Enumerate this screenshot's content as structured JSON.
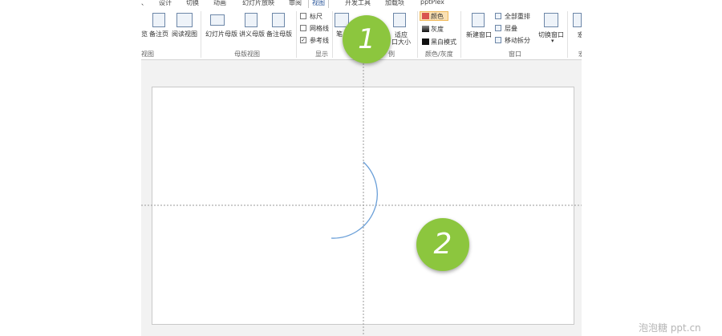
{
  "tabs": [
    "、",
    "设计",
    "切换",
    "动画",
    "幻灯片放映",
    "审阅",
    "视图",
    "开发工具",
    "加载项",
    "pptPlex"
  ],
  "active_tab": "视图",
  "ribbon": {
    "presentation_views": {
      "items": [
        "览",
        "备注页",
        "阅读视图"
      ],
      "group": "视图"
    },
    "master_views": {
      "items": [
        "幻灯片母版",
        "讲义母版",
        "备注母版"
      ],
      "group": "母版视图"
    },
    "show": {
      "ruler": "标尺",
      "gridlines": "网格线",
      "guides": "参考线",
      "guides_checked": "✓",
      "group": "显示"
    },
    "zoom": {
      "zoom_label": "笔",
      "fit_line1": "适应",
      "fit_line2": "口大小",
      "group": "例"
    },
    "color": {
      "color": "颜色",
      "grayscale": "灰度",
      "bw": "黑白模式",
      "group": "颜色/灰度"
    },
    "window": {
      "new_window": "新建窗口",
      "arrange_all": "全部重排",
      "cascade": "层叠",
      "move_split": "移动拆分",
      "switch_windows": "切换窗口",
      "switch_arrow": "▾",
      "group": "窗口"
    },
    "macros_fragment": {
      "label": "宏",
      "group": "宏"
    }
  },
  "badges": [
    "1",
    "2"
  ],
  "watermark": "泡泡糖 ppt.cn",
  "colors": {
    "badge_green": "#8cc63e",
    "arc_blue": "#6a9fd8",
    "guide_gray": "#9a9a9a",
    "active_tab_color": "#2b579a"
  }
}
